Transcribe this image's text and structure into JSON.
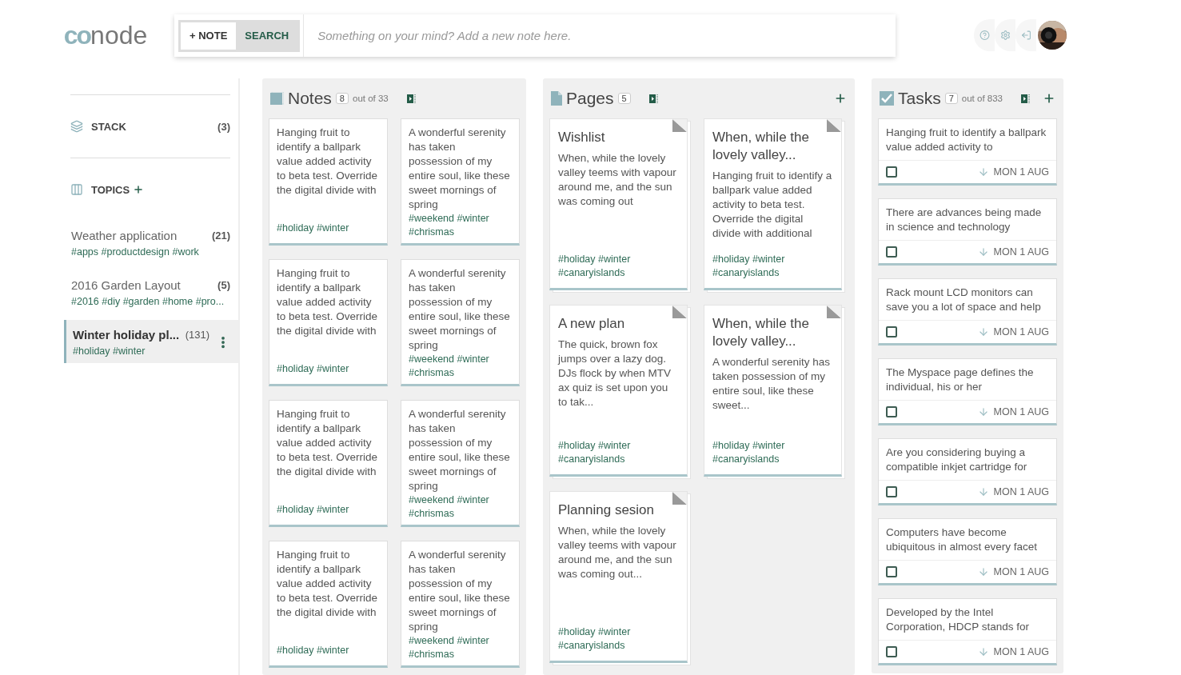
{
  "logo": {
    "mark": "co",
    "word": "node"
  },
  "modes": [
    {
      "label": "+ NOTE",
      "selected": true
    },
    {
      "label": "SEARCH",
      "selected": false
    }
  ],
  "composer": {
    "placeholder": "Something on your mind? Add a new note here."
  },
  "sidebar": {
    "stack": {
      "label": "STACK",
      "count": "(3)"
    },
    "topics_label": "TOPICS",
    "topics": [
      {
        "title": "Weather application",
        "count": "(21)",
        "tags": "#apps #productdesign #work",
        "selected": false
      },
      {
        "title": "2016 Garden Layout",
        "count": "(5)",
        "tags": "#2016 #diy #garden #home #pro...",
        "selected": false
      },
      {
        "title": "Winter holiday pl...",
        "count": "(131)",
        "tags": "#holiday #winter",
        "selected": true
      }
    ]
  },
  "columns": [
    {
      "kind": "notes",
      "title": "Notes",
      "count": "8",
      "total": "out of 33",
      "items": [
        {
          "text": "Hanging fruit to identify a ballpark value added activity to beta test. Override the digital divide with",
          "tags": "#holiday #winter"
        },
        {
          "text": "A wonderful serenity has taken possession of my entire soul, like these sweet mornings of spring",
          "tags": "#weekend #winter #chrismas"
        },
        {
          "text": "Hanging fruit to identify a ballpark value added activity to beta test. Override the digital divide with",
          "tags": "#holiday #winter"
        },
        {
          "text": "A wonderful serenity has taken possession of my entire soul, like these sweet mornings of spring",
          "tags": "#weekend #winter #chrismas"
        },
        {
          "text": "Hanging fruit to identify a ballpark value added activity to beta test. Override the digital divide with",
          "tags": "#holiday #winter"
        },
        {
          "text": "A wonderful serenity has taken possession of my entire soul, like these sweet mornings of spring",
          "tags": "#weekend #winter #chrismas"
        },
        {
          "text": "Hanging fruit to identify a ballpark value added activity to beta test. Override the digital divide with",
          "tags": "#holiday #winter"
        },
        {
          "text": "A wonderful serenity has taken possession of my entire soul, like these sweet mornings of spring",
          "tags": "#weekend #winter #chrismas"
        }
      ]
    },
    {
      "kind": "pages",
      "title": "Pages",
      "count": "5",
      "items": [
        {
          "title": "Wishlist",
          "text": "When, while the lovely valley teems with vapour around me, and the sun was coming out",
          "tags": "#holiday #winter #canaryislands"
        },
        {
          "title": "When, while the lovely valley...",
          "text": "Hanging fruit to identify a ballpark value added activity to beta test. Override the digital divide with additional",
          "tags": "#holiday #winter #canaryislands"
        },
        {
          "title": "A new plan",
          "text": "The quick, brown fox jumps over a lazy dog. DJs flock by when MTV ax quiz is set upon you to tak...",
          "tags": "#holiday #winter #canaryislands"
        },
        {
          "title": "When, while the lovely valley...",
          "text": "A wonderful serenity has taken possession of my entire soul, like these sweet...",
          "tags": "#holiday #winter #canaryislands"
        },
        {
          "title": "Planning sesion",
          "text": "When, while the lovely valley teems with vapour around me, and the sun was coming out...",
          "tags": "#holiday #winter #canaryislands"
        }
      ]
    },
    {
      "kind": "tasks",
      "title": "Tasks",
      "count": "7",
      "total": "out of 833",
      "items": [
        {
          "text": "Hanging fruit to identify a ballpark value added activity to",
          "date": "MON 1 AUG",
          "checked": false
        },
        {
          "text": "There are advances being made in science and technology",
          "date": "MON 1 AUG",
          "checked": false
        },
        {
          "text": "Rack mount LCD monitors can save you a lot of space and help",
          "date": "MON 1 AUG",
          "checked": false
        },
        {
          "text": "The Myspace page defines the individual, his or her",
          "date": "MON 1 AUG",
          "checked": false
        },
        {
          "text": "Are you considering buying a compatible inkjet cartridge for",
          "date": "MON 1 AUG",
          "checked": false
        },
        {
          "text": "Computers have become ubiquitous in almost every facet",
          "date": "MON 1 AUG",
          "checked": false
        },
        {
          "text": "Developed by the Intel Corporation, HDCP stands for",
          "date": "MON 1 AUG",
          "checked": false
        }
      ]
    }
  ]
}
